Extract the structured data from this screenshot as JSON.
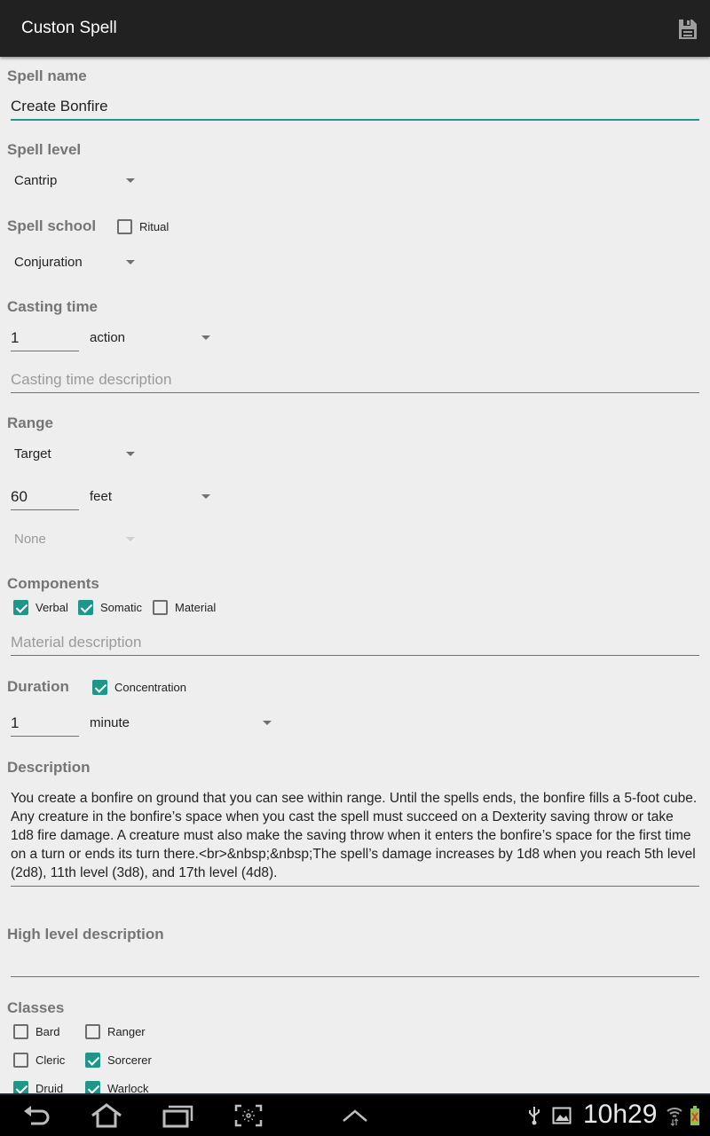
{
  "actionbar": {
    "title": "Custon Spell",
    "save_icon": "floppy-disk-icon"
  },
  "spell_name": {
    "label": "Spell name",
    "value": "Create Bonfire"
  },
  "spell_level": {
    "label": "Spell level",
    "selected": "Cantrip"
  },
  "spell_school": {
    "label": "Spell school",
    "ritual_label": "Ritual",
    "ritual_checked": false,
    "selected": "Conjuration"
  },
  "casting_time": {
    "label": "Casting time",
    "amount": "1",
    "unit": "action",
    "description_placeholder": "Casting time description"
  },
  "range": {
    "label": "Range",
    "type": "Target",
    "amount": "60",
    "unit": "feet",
    "area": "None"
  },
  "components": {
    "label": "Components",
    "items": [
      {
        "label": "Verbal",
        "checked": true
      },
      {
        "label": "Somatic",
        "checked": true
      },
      {
        "label": "Material",
        "checked": false
      }
    ],
    "material_placeholder": "Material description"
  },
  "duration": {
    "label": "Duration",
    "concentration_label": "Concentration",
    "concentration_checked": true,
    "amount": "1",
    "unit": "minute"
  },
  "description": {
    "label": "Description",
    "text": "You create a bonfire on ground that you can see within range. Until the spells ends, the bonfire fills a 5-foot cube. Any creature in the bonfire’s space when you cast the spell must succeed on a Dexterity saving throw or take 1d8 fire damage. A creature must also make the saving throw when it enters the bonfire’s space for the first time on a turn or ends its turn there.<br>&nbsp;&nbsp;The spell’s damage increases by 1d8 when you reach 5th level (2d8), 11th level (3d8), and 17th level (4d8)."
  },
  "high_level": {
    "label": "High level description",
    "value": ""
  },
  "classes": {
    "label": "Classes",
    "items": [
      {
        "label": "Bard",
        "checked": false
      },
      {
        "label": "Ranger",
        "checked": false
      },
      {
        "label": "Cleric",
        "checked": false
      },
      {
        "label": "Sorcerer",
        "checked": true
      },
      {
        "label": "Druid",
        "checked": true
      },
      {
        "label": "Warlock",
        "checked": true
      }
    ]
  },
  "statusbar": {
    "time": "10h29"
  },
  "colors": {
    "accent": "#1f9688",
    "actionbar": "#212121",
    "background": "#eeeeee"
  }
}
